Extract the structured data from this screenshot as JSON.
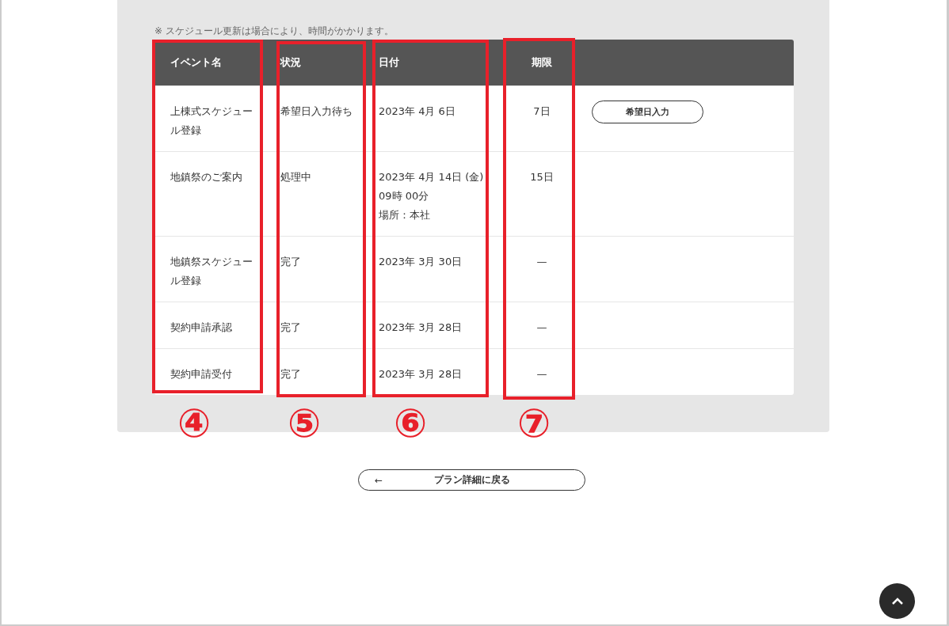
{
  "note": "※ スケジュール更新は場合により、時間がかかります。",
  "table": {
    "columns": [
      "イベント名",
      "状況",
      "日付",
      "期限"
    ],
    "rows": [
      {
        "name": "上棟式スケジュール登録",
        "status": "希望日入力待ち",
        "date": [
          "2023年 4月 6日"
        ],
        "deadline": "7日",
        "action": "希望日入力"
      },
      {
        "name": "地鎮祭のご案内",
        "status": "処理中",
        "date": [
          "2023年 4月 14日 (金)",
          "09時 00分",
          "場所：本社"
        ],
        "deadline": "15日"
      },
      {
        "name": "地鎮祭スケジュール登録",
        "status": "完了",
        "date": [
          "2023年 3月 30日"
        ],
        "deadline": "—"
      },
      {
        "name": "契約申請承認",
        "status": "完了",
        "date": [
          "2023年 3月 28日"
        ],
        "deadline": "—"
      },
      {
        "name": "契約申請受付",
        "status": "完了",
        "date": [
          "2023年 3月 28日"
        ],
        "deadline": "—"
      }
    ]
  },
  "annotations": [
    "④",
    "⑤",
    "⑥",
    "⑦"
  ],
  "back_button": {
    "arrow": "←",
    "label": "プラン詳細に戻る"
  }
}
